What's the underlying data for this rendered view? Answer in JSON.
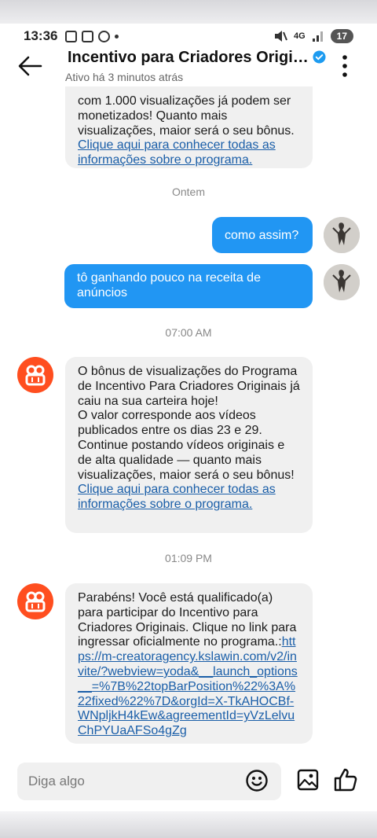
{
  "status_bar": {
    "time": "13:36",
    "network": "4G",
    "battery": "17"
  },
  "header": {
    "title": "Incentivo para Criadores Origin...",
    "subtitle": "Ativo há 3 minutos atrás"
  },
  "messages": {
    "m0_text": "com 1.000 visualizações já podem ser monetizados! Quanto mais visualizações, maior será o seu bônus.",
    "m0_link": "Clique aqui para conhecer todas as informações sobre o programa.",
    "stamp1": "Ontem",
    "out1": "como assim?",
    "out2": "tô ganhando pouco na receita de anúncios",
    "stamp2": "07:00 AM",
    "m3_text": "O bônus de visualizações do Programa de Incentivo Para Criadores Originais já caiu na sua carteira hoje!\nO valor corresponde aos vídeos publicados entre os dias 23 e 29.\nContinue postando vídeos originais e de alta qualidade — quanto mais visualizações, maior será o seu bônus!",
    "m3_link": "Clique aqui para conhecer todas as informações sobre o programa.",
    "stamp3": "01:09 PM",
    "m4_text": "Parabéns! Você está qualificado(a) para participar do Incentivo para Criadores Originais. Clique no link para ingressar oficialmente no programa.:",
    "m4_link": "https://m-creatoragency.kslawin.com/v2/invite/?webview=yoda&__launch_options__=%7B%22topBarPosition%22%3A%22fixed%22%7D&orgId=X-TkAHOCBf-WNpljkH4kEw&agreementId=yVzLelvuChPYUaAFSo4gZg"
  },
  "composer": {
    "placeholder": "Diga algo"
  },
  "icons": {
    "back": "arrow-left-icon",
    "verified": "verified-badge-icon",
    "menu": "more-vertical-icon",
    "emoji": "emoji-icon",
    "image": "image-icon",
    "like": "thumbs-up-icon"
  },
  "colors": {
    "outgoing_bubble": "#2196f3",
    "link": "#1a5ea8",
    "brand": "#ff4e1f",
    "verified": "#1d9bf0"
  }
}
